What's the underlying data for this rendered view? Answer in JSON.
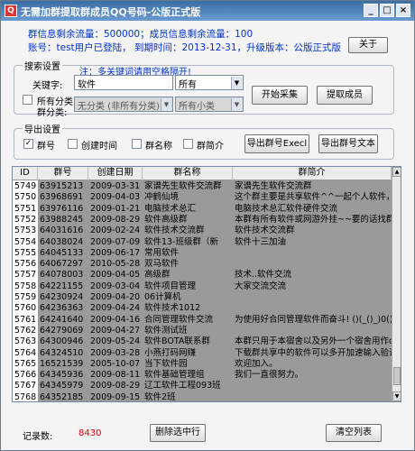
{
  "window": {
    "title": "无需加群提取群成员QQ号码-公版正式版"
  },
  "info": {
    "line1": "群信息剩余流量：500000；成员信息剩余流量：100",
    "line2": "账号：test用户已登陆， 到期时间：2013-12-31，升级版本：公版正式版"
  },
  "buttons": {
    "about": "关于",
    "start": "开始采集",
    "extract": "提取成员",
    "export_excel": "导出群号Execl",
    "export_text": "导出群号文本",
    "delete_selected": "删除选中行",
    "clear_list": "清空列表"
  },
  "search": {
    "group_label": "搜索设置",
    "hint": "注：多关键词请用空格隔开!",
    "keyword_label": "关键字:",
    "keyword_value": "软件",
    "keyword_scope": "所有",
    "all_categories_label": "所有分类",
    "category_label": "群分类:",
    "category_value": "无分类 (非所有分类)",
    "subcategory_value": "所有小类"
  },
  "export": {
    "group_label": "导出设置",
    "options": [
      {
        "label": "群号",
        "checked": "✓"
      },
      {
        "label": "创建时间",
        "checked": ""
      },
      {
        "label": "群名称",
        "checked": ""
      },
      {
        "label": "群简介",
        "checked": ""
      }
    ]
  },
  "table": {
    "columns": [
      "ID",
      "群号",
      "创建日期",
      "群名称",
      "群简介"
    ],
    "rows": [
      [
        "5749",
        "63915213",
        "2009-03-31",
        "家谱先生软件交流群",
        "家谱先生软件交流群"
      ],
      [
        "5750",
        "63968691",
        "2009-04-03",
        "冲鹤仙境",
        "这个群主要是共享软件^^一起个人软件，呵呵("
      ],
      [
        "5751",
        "63976116",
        "2009-01-21",
        "电脑技术总汇",
        "电脑技术总汇软件硬件交流"
      ],
      [
        "5752",
        "63988245",
        "2009-08-29",
        "软件高级群",
        "本群有所有软件或网游外挂~~要的话找群主谈!"
      ],
      [
        "5753",
        "64031616",
        "2009-02-24",
        "软件技术交流群",
        "软件技术交流群"
      ],
      [
        "5754",
        "64038024",
        "2009-07-09",
        "软件13-班级群（新",
        "软件十三加油"
      ],
      [
        "5755",
        "64045133",
        "2009-06-17",
        "常用软件",
        ""
      ],
      [
        "5756",
        "64067297",
        "2010-05-28",
        "双马软件",
        ""
      ],
      [
        "5757",
        "64078003",
        "2009-04-05",
        "高级群",
        "技术..软件交流"
      ],
      [
        "5758",
        "64221155",
        "2009-03-04",
        "软件项目管理",
        "大家交流交流"
      ],
      [
        "5759",
        "64230924",
        "2009-04-20",
        "06计算机",
        ""
      ],
      [
        "5760",
        "64236363",
        "2009-04-24",
        "软件技术1012",
        ""
      ],
      [
        "5761",
        "64241640",
        "2009-04-16",
        "合同管理软件交流",
        "为使用好合同管理软件而奋斗! ()(_()_)0()哈哈"
      ],
      [
        "5762",
        "64279069",
        "2009-04-27",
        "软件测试班",
        ""
      ],
      [
        "5763",
        "64300946",
        "2009-05-24",
        "软件BOTA联系群",
        "本群只用于本宿舍以及另外一个宿舍用作data联"
      ],
      [
        "5764",
        "64324510",
        "2009-03-28",
        "小燕打码网赚",
        "下载群共享中的软件可以多开加速输入验证码!"
      ],
      [
        "5765",
        "16521539",
        "2005-10-07",
        "当下软件园",
        "欢迎加入。"
      ],
      [
        "5766",
        "64345936",
        "2009-08-11",
        "软件基础管理组",
        "我们一直很努力。"
      ],
      [
        "5767",
        "64345979",
        "2009-08-29",
        "辽工软件工程093班",
        ""
      ],
      [
        "5768",
        "64352185",
        "2009-09-15",
        "软件2班",
        ""
      ]
    ]
  },
  "footer": {
    "count_label": "记录数:",
    "count_value": "8430"
  }
}
